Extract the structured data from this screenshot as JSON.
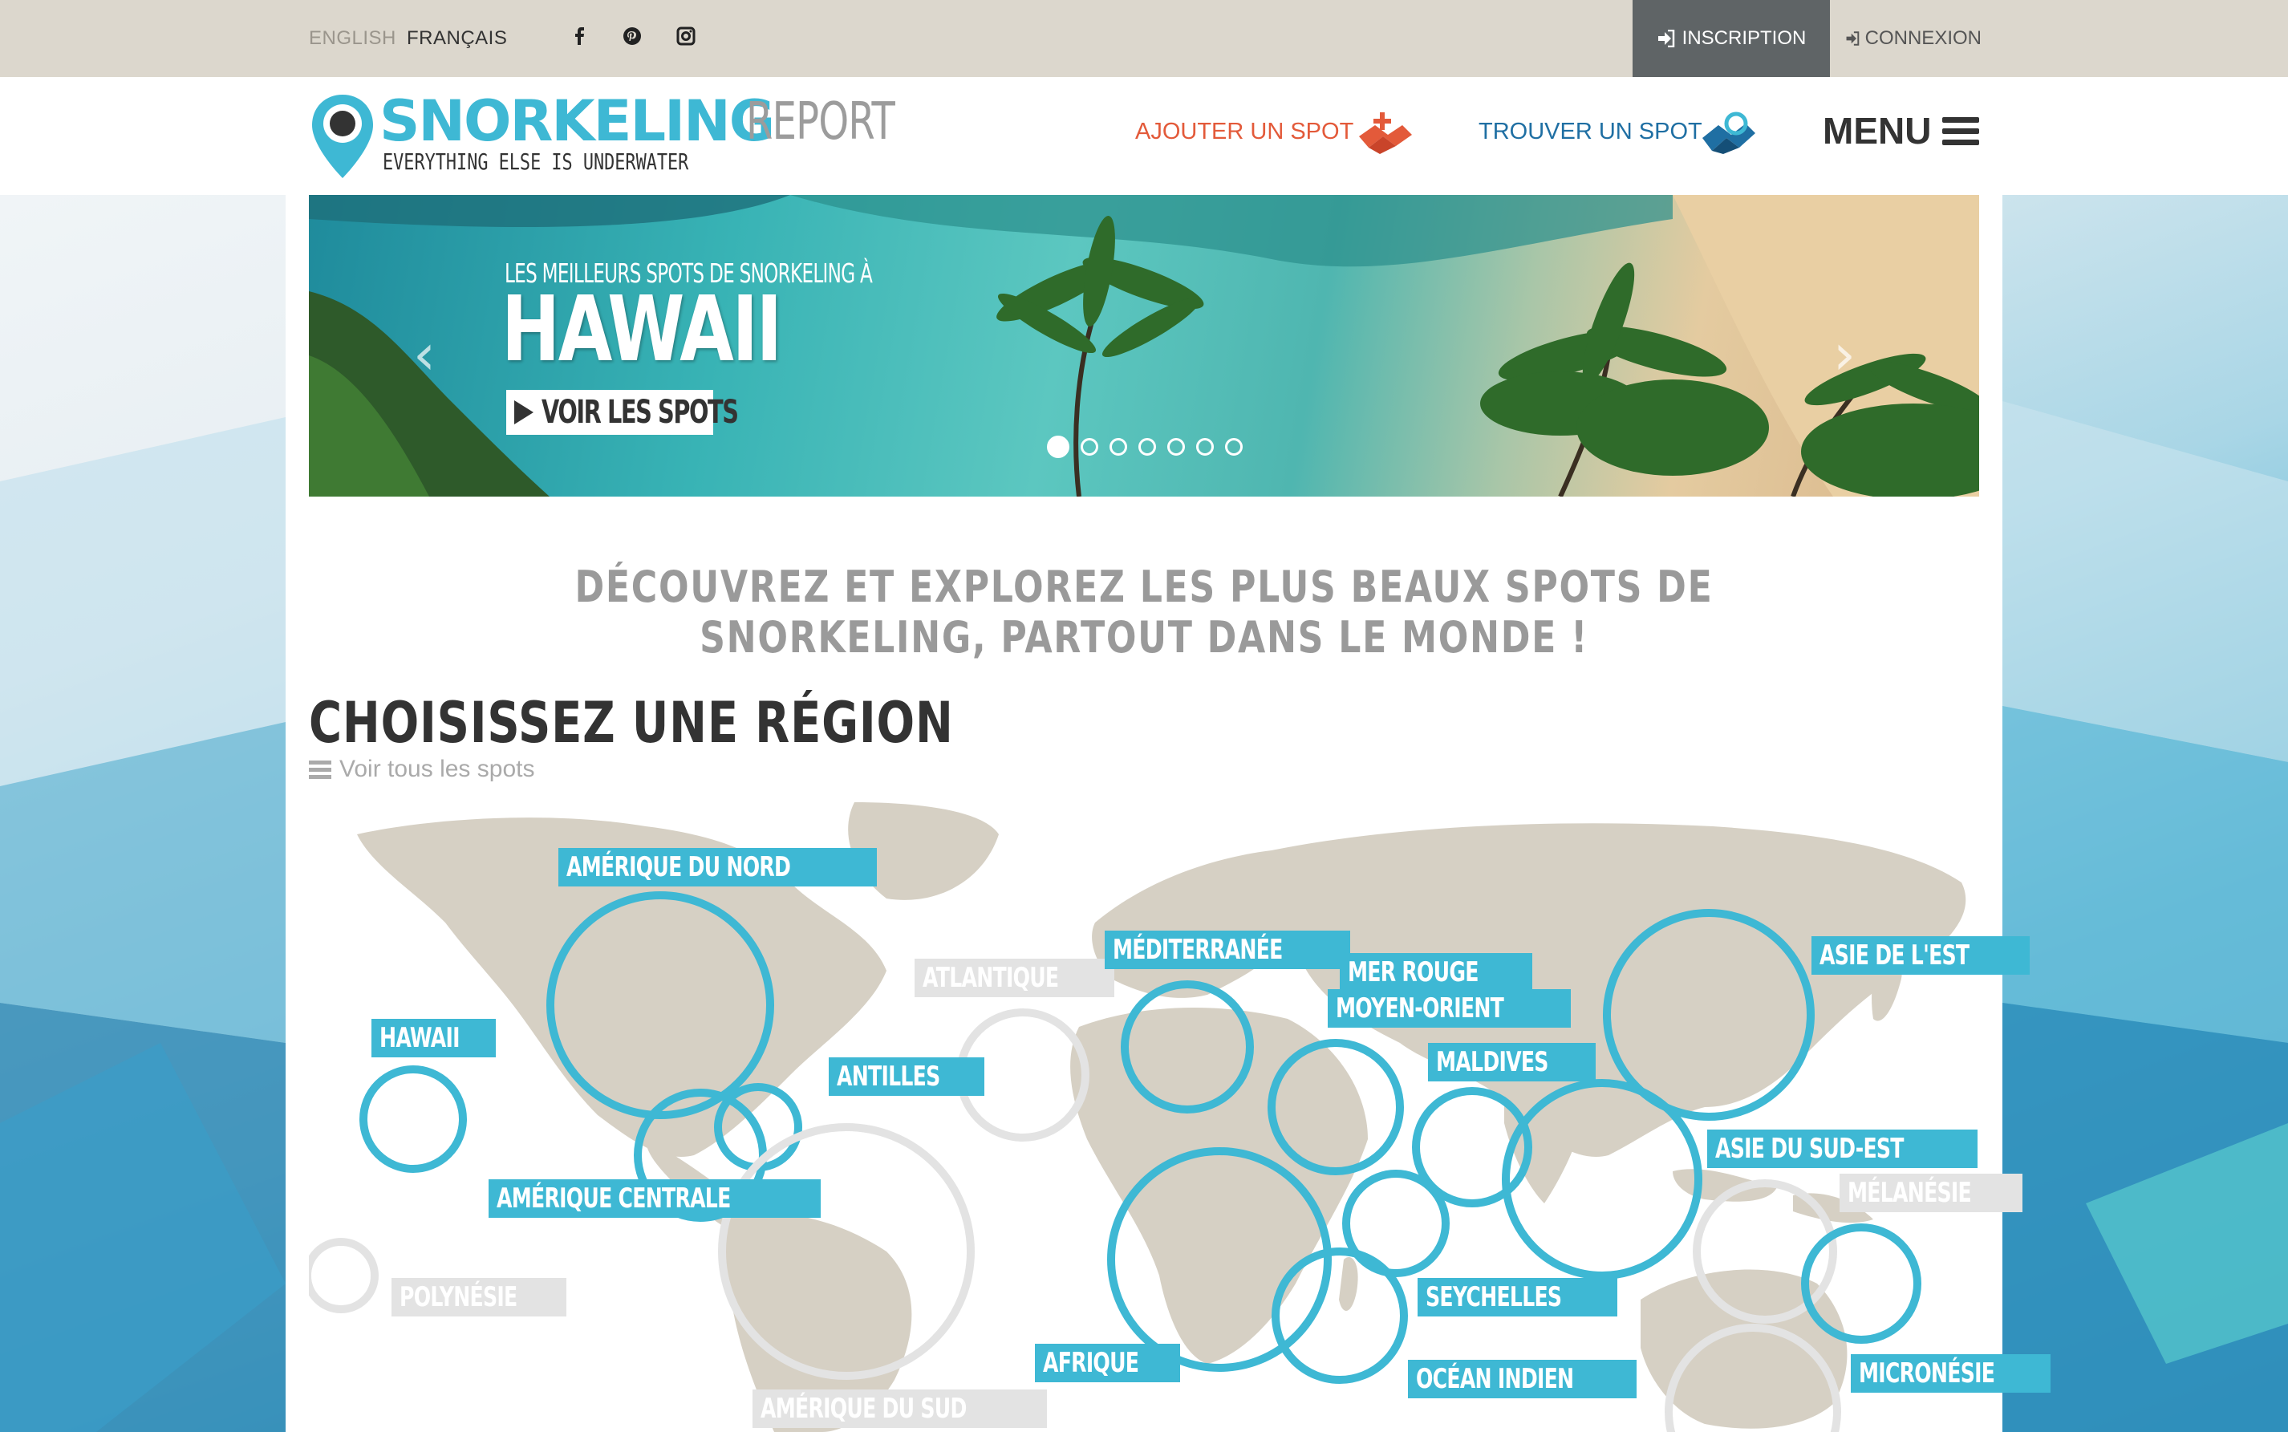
{
  "topbar": {
    "lang_en": "ENGLISH",
    "lang_fr": "FRANÇAIS",
    "inscription": "INSCRIPTION",
    "connexion": "CONNEXION"
  },
  "logo": {
    "main": "SNORKELING",
    "report": "REPORT",
    "tagline": "EVERYTHING ELSE IS UNDERWATER"
  },
  "header": {
    "add_spot": "AJOUTER UN SPOT",
    "find_spot": "TROUVER UN SPOT",
    "menu": "MENU"
  },
  "slider": {
    "kicker": "LES MEILLEURS SPOTS DE SNORKELING À",
    "title": "HAWAII",
    "cta": "VOIR LES SPOTS",
    "dot_count": 7,
    "active_dot": 1
  },
  "intro": {
    "tagline": "DÉCOUVREZ ET EXPLOREZ LES PLUS BEAUX SPOTS DE SNORKELING, PARTOUT DANS LE MONDE !",
    "section_title": "CHOISISSEZ UNE RÉGION",
    "see_all": "Voir tous les spots"
  },
  "regions": {
    "amerique_nord": "AMÉRIQUE DU NORD",
    "hawaii": "HAWAII",
    "antilles": "ANTILLES",
    "amerique_centrale": "AMÉRIQUE CENTRALE",
    "polynesie": "POLYNÉSIE",
    "amerique_sud": "AMÉRIQUE DU SUD",
    "atlantique": "ATLANTIQUE",
    "mediterranee": "MÉDITERRANÉE",
    "mer_rouge": "MER ROUGE",
    "moyen_orient": "MOYEN-ORIENT",
    "maldives": "MALDIVES",
    "afrique": "AFRIQUE",
    "seychelles": "SEYCHELLES",
    "ocean_indien": "OCÉAN INDIEN",
    "asie_est": "ASIE DE L'EST",
    "asie_sud_est": "ASIE DU SUD-EST",
    "melanesie": "MÉLANÉSIE",
    "micronesie": "MICRONÉSIE"
  },
  "colors": {
    "accent": "#3eb8d4",
    "add_spot": "#e35a3a",
    "find_spot": "#1f6fa3",
    "topbar": "#dcd7cd",
    "inscription_bg": "#5f6466",
    "land": "#d6d0c4",
    "inactive": "#e3e3e3"
  }
}
